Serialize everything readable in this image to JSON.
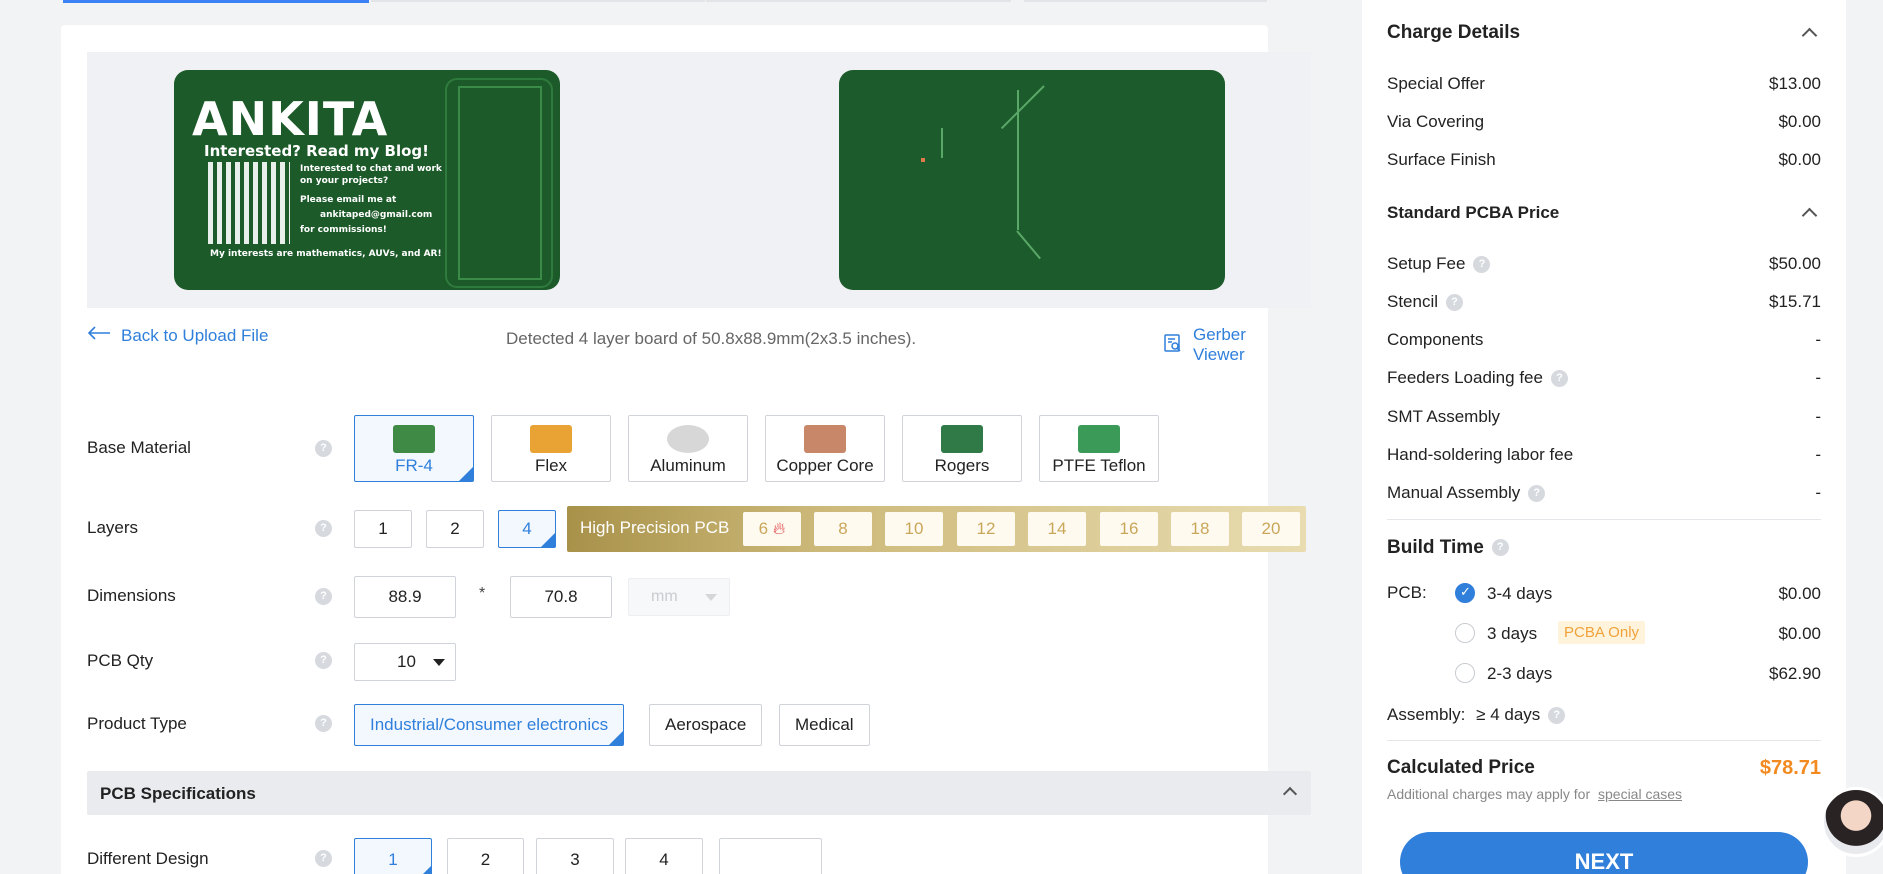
{
  "preview": {
    "front": {
      "title": "ANKITA",
      "subtitle": "Interested? Read my Blog!",
      "lines": [
        "Interested to chat and work",
        "on your projects?",
        "Please email me at",
        "ankitaped@gmail.com",
        "for commissions!",
        "My interests are mathematics, AUVs, and AR!"
      ]
    }
  },
  "back_link": "Back to Upload File",
  "detected_text": "Detected 4 layer board of 50.8x88.9mm(2x3.5 inches).",
  "gerber_link": "Gerber Viewer",
  "base_material": {
    "label": "Base Material",
    "options": [
      "FR-4",
      "Flex",
      "Aluminum",
      "Copper Core",
      "Rogers",
      "PTFE Teflon"
    ],
    "selected": "FR-4"
  },
  "layers": {
    "label": "Layers",
    "options": [
      "1",
      "2",
      "4"
    ],
    "selected": "4",
    "high_precision_label": "High Precision PCB",
    "high_precision_options": [
      "6",
      "8",
      "10",
      "12",
      "14",
      "16",
      "18",
      "20"
    ]
  },
  "dimensions": {
    "label": "Dimensions",
    "length": "88.9",
    "separator": "*",
    "width": "70.8",
    "unit": "mm"
  },
  "pcb_qty": {
    "label": "PCB Qty",
    "value": "10"
  },
  "product_type": {
    "label": "Product Type",
    "options": [
      "Industrial/Consumer electronics",
      "Aerospace",
      "Medical"
    ],
    "selected": "Industrial/Consumer electronics"
  },
  "pcb_specifications": {
    "title": "PCB Specifications"
  },
  "different_design": {
    "label": "Different Design",
    "options": [
      "1",
      "2",
      "3",
      "4"
    ],
    "selected": "1",
    "custom_value": ""
  },
  "charge_details": {
    "title": "Charge Details",
    "items": [
      {
        "label": "Special Offer",
        "value": "$13.00"
      },
      {
        "label": "Via Covering",
        "value": "$0.00"
      },
      {
        "label": "Surface Finish",
        "value": "$0.00"
      }
    ]
  },
  "pcba_price": {
    "title": "Standard PCBA Price",
    "items": [
      {
        "label": "Setup Fee",
        "value": "$50.00"
      },
      {
        "label": "Stencil",
        "value": "$15.71"
      },
      {
        "label": "Components",
        "value": "-"
      },
      {
        "label": "Feeders Loading fee",
        "value": "-"
      },
      {
        "label": "SMT Assembly",
        "value": "-"
      },
      {
        "label": "Hand-soldering labor fee",
        "value": "-"
      },
      {
        "label": "Manual Assembly",
        "value": "-"
      }
    ]
  },
  "build_time": {
    "title": "Build Time",
    "pcb_label": "PCB:",
    "options": [
      {
        "label": "3-4 days",
        "value": "$0.00",
        "selected": true
      },
      {
        "label": "3 days",
        "value": "$0.00",
        "badge": "PCBA Only"
      },
      {
        "label": "2-3 days",
        "value": "$62.90"
      }
    ],
    "assembly_label": "Assembly:",
    "assembly_value": "≥ 4 days"
  },
  "calculated": {
    "title": "Calculated Price",
    "value": "$78.71",
    "note": "Additional charges may apply for",
    "note_link": "special cases"
  },
  "next_button": "NEXT",
  "colors": {
    "accent": "#2f7fdb",
    "price": "#f28a20",
    "board": "#1d5a2a"
  }
}
